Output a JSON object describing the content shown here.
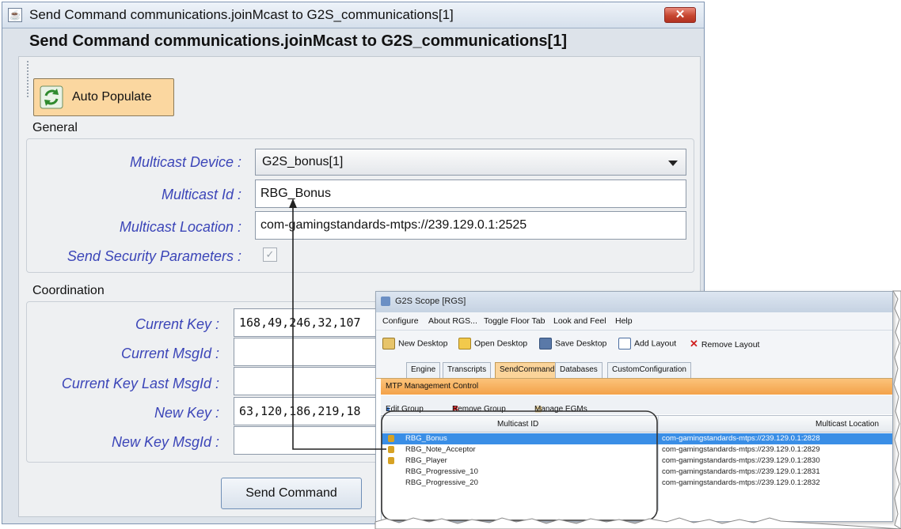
{
  "dialog": {
    "title": "Send Command communications.joinMcast to G2S_communications[1]",
    "close_glyph": "✕",
    "app_icon_glyph": "☕",
    "heading": "Send Command communications.joinMcast to G2S_communications[1]",
    "auto_populate_label": "Auto Populate",
    "general": {
      "label": "General",
      "multicast_device_label": "Multicast Device :",
      "multicast_device_value": "G2S_bonus[1]",
      "multicast_id_label": "Multicast Id :",
      "multicast_id_value": "RBG_Bonus",
      "multicast_location_label": "Multicast Location :",
      "multicast_location_value": "com-gamingstandards-mtps://239.129.0.1:2525",
      "send_security_label": "Send Security Parameters :",
      "send_security_checked": true
    },
    "coordination": {
      "label": "Coordination",
      "current_key_label": "Current Key :",
      "current_key_value": "168,49,246,32,107",
      "current_msgid_label": "Current MsgId :",
      "current_msgid_value": "",
      "current_key_last_msgid_label": "Current Key Last MsgId :",
      "current_key_last_msgid_value": "",
      "new_key_label": "New Key :",
      "new_key_value": "63,120,186,219,18",
      "new_key_msgid_label": "New Key MsgId :",
      "new_key_msgid_value": ""
    },
    "send_command_label": "Send Command"
  },
  "scope": {
    "title": "G2S Scope [RGS]",
    "menu": [
      "Configure",
      "About RGS...",
      "Toggle Floor Tab",
      "Look and Feel",
      "Help"
    ],
    "toolbar": {
      "new_desktop": "New Desktop",
      "open_desktop": "Open Desktop",
      "save_desktop": "Save Desktop",
      "add_layout": "Add Layout",
      "remove_layout": "Remove Layout"
    },
    "tabs": [
      "Engine",
      "Transcripts",
      "SendCommand",
      "Databases",
      "CustomConfiguration"
    ],
    "active_tab": "SendCommand",
    "panel_title": "MTP Management Control",
    "panel_tools": {
      "edit_group": "Edit Group",
      "remove_group": "Remove Group",
      "manage_egms": "Manage EGMs"
    },
    "table": {
      "columns": [
        "Multicast ID",
        "Multicast Location"
      ],
      "rows": [
        {
          "id": "RBG_Bonus",
          "location": "com-gamingstandards-mtps://239.129.0.1:2828",
          "locked": true,
          "selected": true
        },
        {
          "id": "RBG_Note_Acceptor",
          "location": "com-gamingstandards-mtps://239.129.0.1:2829",
          "locked": true,
          "selected": false
        },
        {
          "id": "RBG_Player",
          "location": "com-gamingstandards-mtps://239.129.0.1:2830",
          "locked": true,
          "selected": false
        },
        {
          "id": "RBG_Progressive_10",
          "location": "com-gamingstandards-mtps://239.129.0.1:2831",
          "locked": false,
          "selected": false
        },
        {
          "id": "RBG_Progressive_20",
          "location": "com-gamingstandards-mtps://239.129.0.1:2832",
          "locked": false,
          "selected": false
        }
      ]
    }
  },
  "icons": {
    "app": "java-cup-icon",
    "auto_populate": "refresh-icon",
    "close": "close-icon",
    "lock": "lock-icon"
  },
  "colors": {
    "label_blue": "#3b45b8",
    "auto_populate_bg": "#fbd7a0",
    "close_red": "#c64630",
    "selected_row": "#3a8ee6",
    "active_tab": "#fbd49a"
  }
}
